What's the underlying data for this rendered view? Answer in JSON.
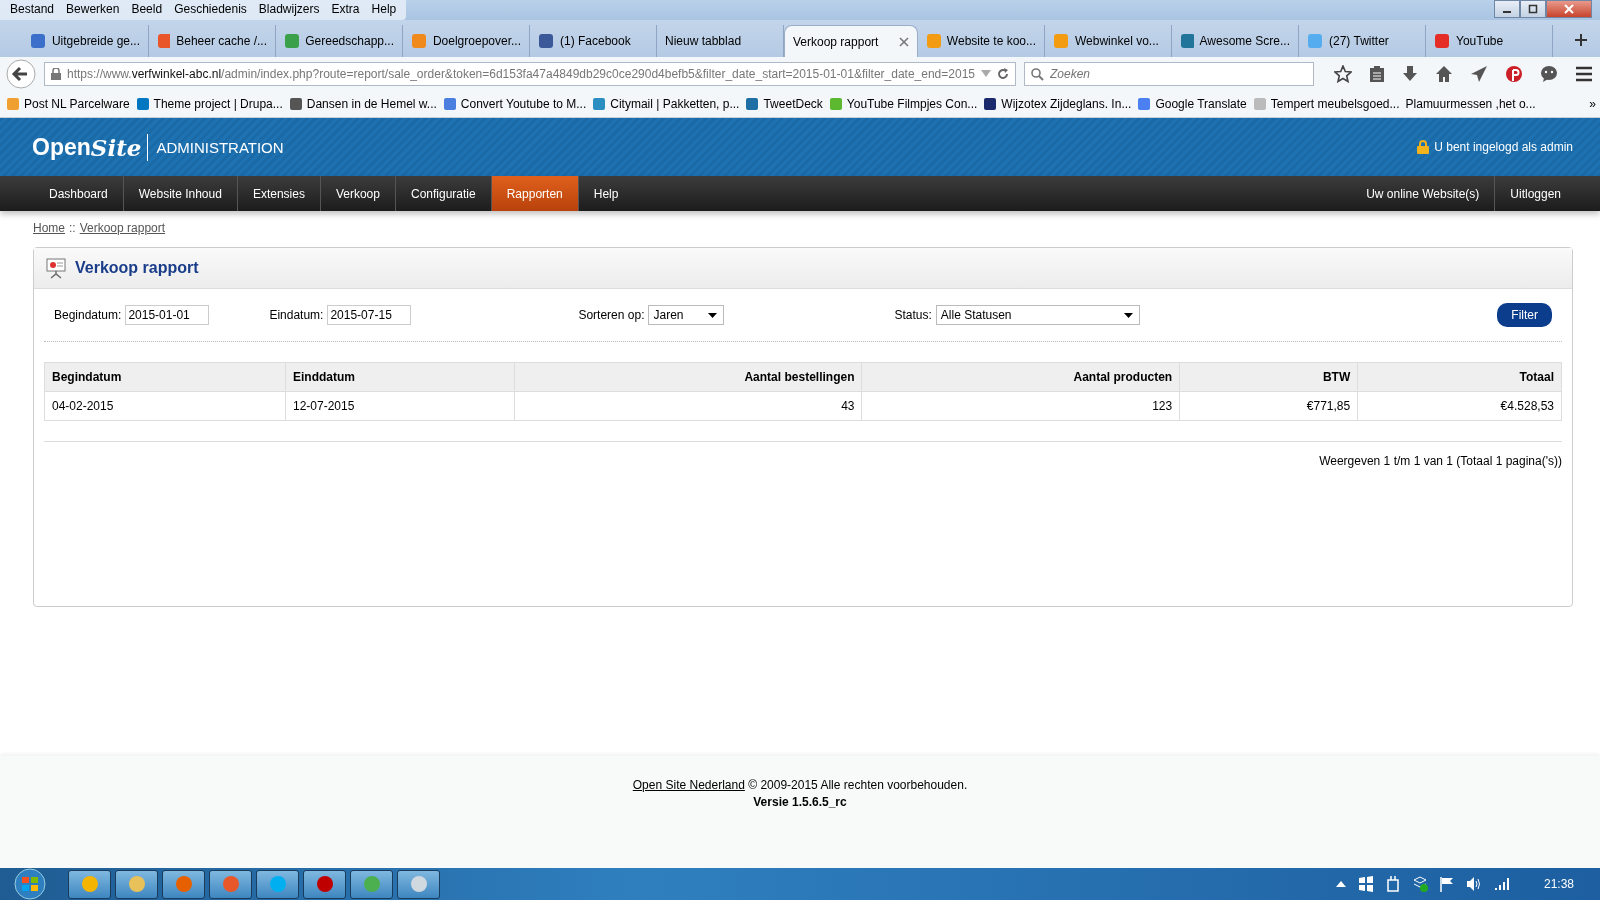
{
  "browser": {
    "menu": [
      "Bestand",
      "Bewerken",
      "Beeld",
      "Geschiedenis",
      "Bladwijzers",
      "Extra",
      "Help"
    ],
    "tabs": [
      {
        "label": "Uitgebreide ge...",
        "selected": false,
        "color": "#3b6fc9"
      },
      {
        "label": "Beheer cache /...",
        "selected": false,
        "color": "#e8562a"
      },
      {
        "label": "Gereedschapp...",
        "selected": false,
        "color": "#3aa04a"
      },
      {
        "label": "Doelgroepover...",
        "selected": false,
        "color": "#f08a1c"
      },
      {
        "label": "(1) Facebook",
        "selected": false,
        "color": "#3b5998"
      },
      {
        "label": "Nieuw tabblad",
        "selected": false
      },
      {
        "label": "Verkoop rapport",
        "selected": true
      },
      {
        "label": "Website te koo...",
        "selected": false,
        "color": "#f39c12"
      },
      {
        "label": "Webwinkel vo...",
        "selected": false,
        "color": "#f39c12"
      },
      {
        "label": "Awesome Scre...",
        "selected": false,
        "color": "#21759b"
      },
      {
        "label": "(27) Twitter",
        "selected": false,
        "color": "#55acee"
      },
      {
        "label": "YouTube",
        "selected": false,
        "color": "#e52d27"
      }
    ],
    "address": {
      "prefix": "https://www.",
      "domain": "verfwinkel-abc.nl",
      "path": "/admin/index.php?route=report/sale_order&token=6d153fa47a4849db29c0ce290d4befb5&filter_date_start=2015-01-01&filter_date_end=2015"
    },
    "search": {
      "placeholder": "Zoeken"
    },
    "bookmarks": [
      {
        "label": "Post NL Parcelware",
        "color": "#f0a030"
      },
      {
        "label": "Theme project | Drupa...",
        "color": "#0077c0"
      },
      {
        "label": "Dansen in de Hemel w...",
        "color": "#555555"
      },
      {
        "label": "Convert Youtube to M...",
        "color": "#4a7fe0"
      },
      {
        "label": "Citymail | Pakketten, p...",
        "color": "#2a8fc0"
      },
      {
        "label": "TweetDeck",
        "color": "#1d6fa5"
      },
      {
        "label": "YouTube Filmpjes Con...",
        "color": "#5cb82e"
      },
      {
        "label": "Wijzotex Zijdeglans. In...",
        "color": "#1a2a6a"
      },
      {
        "label": "Google Translate",
        "color": "#4a80f0"
      },
      {
        "label": "Tempert meubelsgoed...",
        "color": "#bbbbbb"
      },
      {
        "label": "Plamuurmessen ,het o..."
      }
    ],
    "bookmarks_overflow": "»"
  },
  "header": {
    "logo_word": "Open",
    "logo_script": "Site",
    "title": "ADMINISTRATION",
    "login": "U bent ingelogd als admin"
  },
  "nav": {
    "left": [
      {
        "label": "Dashboard",
        "selected": false
      },
      {
        "label": "Website Inhoud",
        "selected": false
      },
      {
        "label": "Extensies",
        "selected": false
      },
      {
        "label": "Verkoop",
        "selected": false
      },
      {
        "label": "Configuratie",
        "selected": false
      },
      {
        "label": "Rapporten",
        "selected": true
      },
      {
        "label": "Help",
        "selected": false
      }
    ],
    "right": [
      "Uw online Website(s)",
      "Uitloggen"
    ]
  },
  "breadcrumb": {
    "items": [
      "Home",
      "Verkoop rapport"
    ],
    "separator": "::"
  },
  "panel": {
    "title": "Verkoop rapport",
    "filters": {
      "start_label": "Begindatum:",
      "start_value": "2015-01-01",
      "end_label": "Eindatum:",
      "end_value": "2015-07-15",
      "sort_label": "Sorteren op:",
      "sort_value": "Jaren",
      "status_label": "Status:",
      "status_value": "Alle Statusen",
      "button": "Filter"
    },
    "table": {
      "columns": [
        "Begindatum",
        "Einddatum",
        "Aantal bestellingen",
        "Aantal producten",
        "BTW",
        "Totaal"
      ],
      "rows": [
        [
          "04-02-2015",
          "12-07-2015",
          "43",
          "123",
          "€771,85",
          "€4.528,53"
        ]
      ]
    },
    "pagination": "Weergeven 1 t/m 1 van 1 (Totaal 1 pagina('s))"
  },
  "footer": {
    "link": "Open Site Nederland",
    "text": "© 2009-2015 Alle rechten voorbehouden.",
    "version": "Versie 1.5.6.5_rc"
  },
  "taskbar": {
    "clock": "21:38"
  }
}
